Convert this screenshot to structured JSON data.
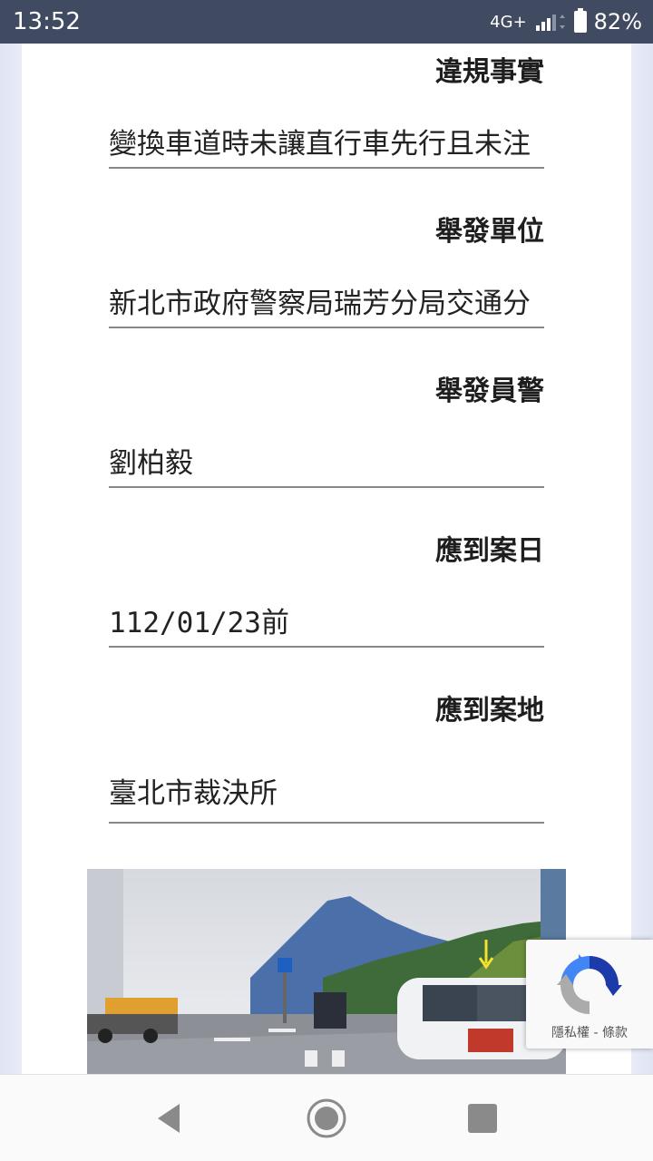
{
  "status_bar": {
    "time": "13:52",
    "network": "4G+",
    "battery": "82%"
  },
  "fields": [
    {
      "label": "違規事實",
      "value": "變換車道時未讓直行車先行且未注"
    },
    {
      "label": "舉發單位",
      "value": "新北市政府警察局瑞芳分局交通分"
    },
    {
      "label": "舉發員警",
      "value": "劉柏毅"
    },
    {
      "label": "應到案日",
      "value": "112/01/23前"
    },
    {
      "label": "應到案地",
      "value": "臺北市裁決所"
    }
  ],
  "recaptcha": {
    "links": "隱私權 - 條款"
  },
  "navigation": {
    "buttons": [
      "back-icon",
      "home-icon",
      "recents-icon"
    ]
  },
  "colors": {
    "status_bar": "#404a61",
    "recaptcha_blue": "#1c3aa9",
    "recaptcha_light": "#4285f4",
    "recaptcha_gray": "#ababab"
  }
}
